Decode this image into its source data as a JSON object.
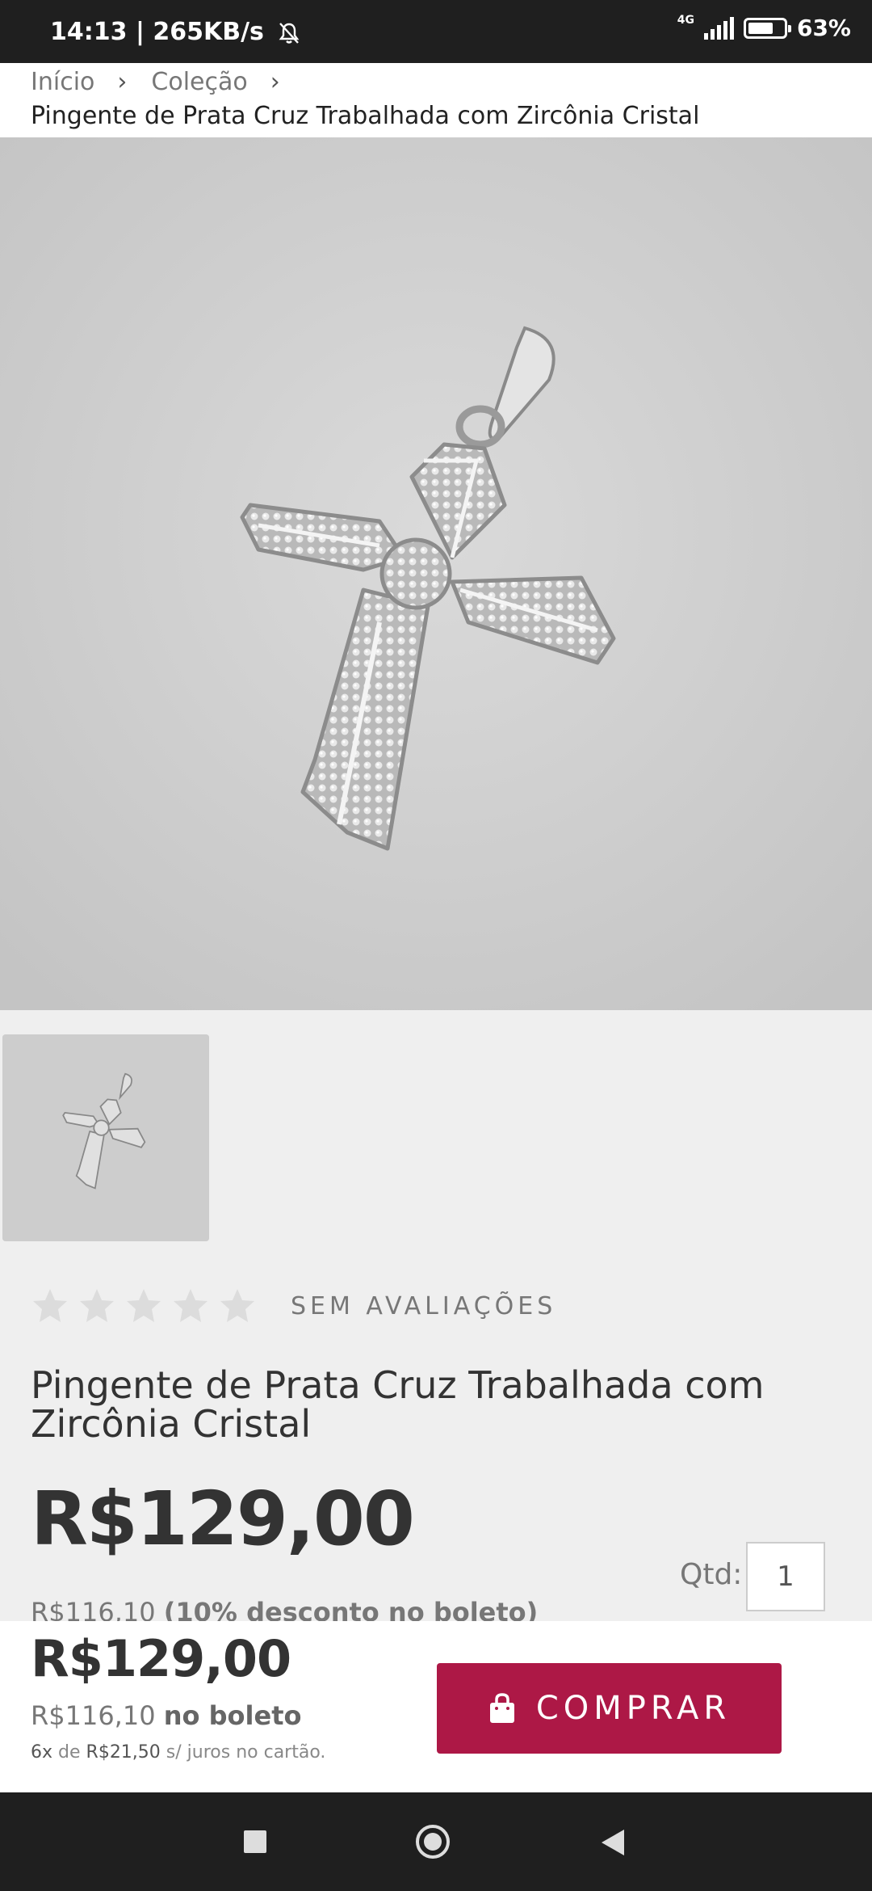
{
  "status_bar": {
    "time": "14:13",
    "network_speed": "| 265KB/s",
    "network_type": "4G",
    "battery": "63%",
    "icons": [
      "bell-off-icon",
      "signal-icon",
      "battery-icon"
    ]
  },
  "breadcrumb": {
    "items": [
      "Início",
      "Coleção"
    ],
    "separator_icon": "chevron-right-icon",
    "current": "Pingente de Prata Cruz Trabalhada com Zircônia Cristal"
  },
  "gallery": {
    "main_image_alt": "Pingente de Prata Cruz Trabalhada com Zircônia Cristal",
    "thumbnails": 1
  },
  "rating": {
    "stars": 5,
    "filled": 0,
    "label": "SEM AVALIAÇÕES"
  },
  "product": {
    "name": "Pingente de Prata Cruz Trabalhada com Zircônia Cristal",
    "price": "R$129,00",
    "boleto_price": "R$116,10",
    "boleto_note": "(10% desconto no boleto)"
  },
  "quantity": {
    "label": "Qtd:",
    "value": "1"
  },
  "sticky_bar": {
    "price": "R$129,00",
    "boleto_price": "R$116,10",
    "boleto_label": "no boleto",
    "installments_count": "6x",
    "installments_text_1": "de",
    "installments_value": "R$21,50",
    "installments_text_2": "s/ juros no cartão.",
    "buy_label": "COMPRAR",
    "buy_icon": "shopping-bag-icon",
    "buy_color": "#ad1846"
  },
  "nav_bar": {
    "icons": [
      "recent-apps-icon",
      "home-icon",
      "back-icon"
    ]
  }
}
